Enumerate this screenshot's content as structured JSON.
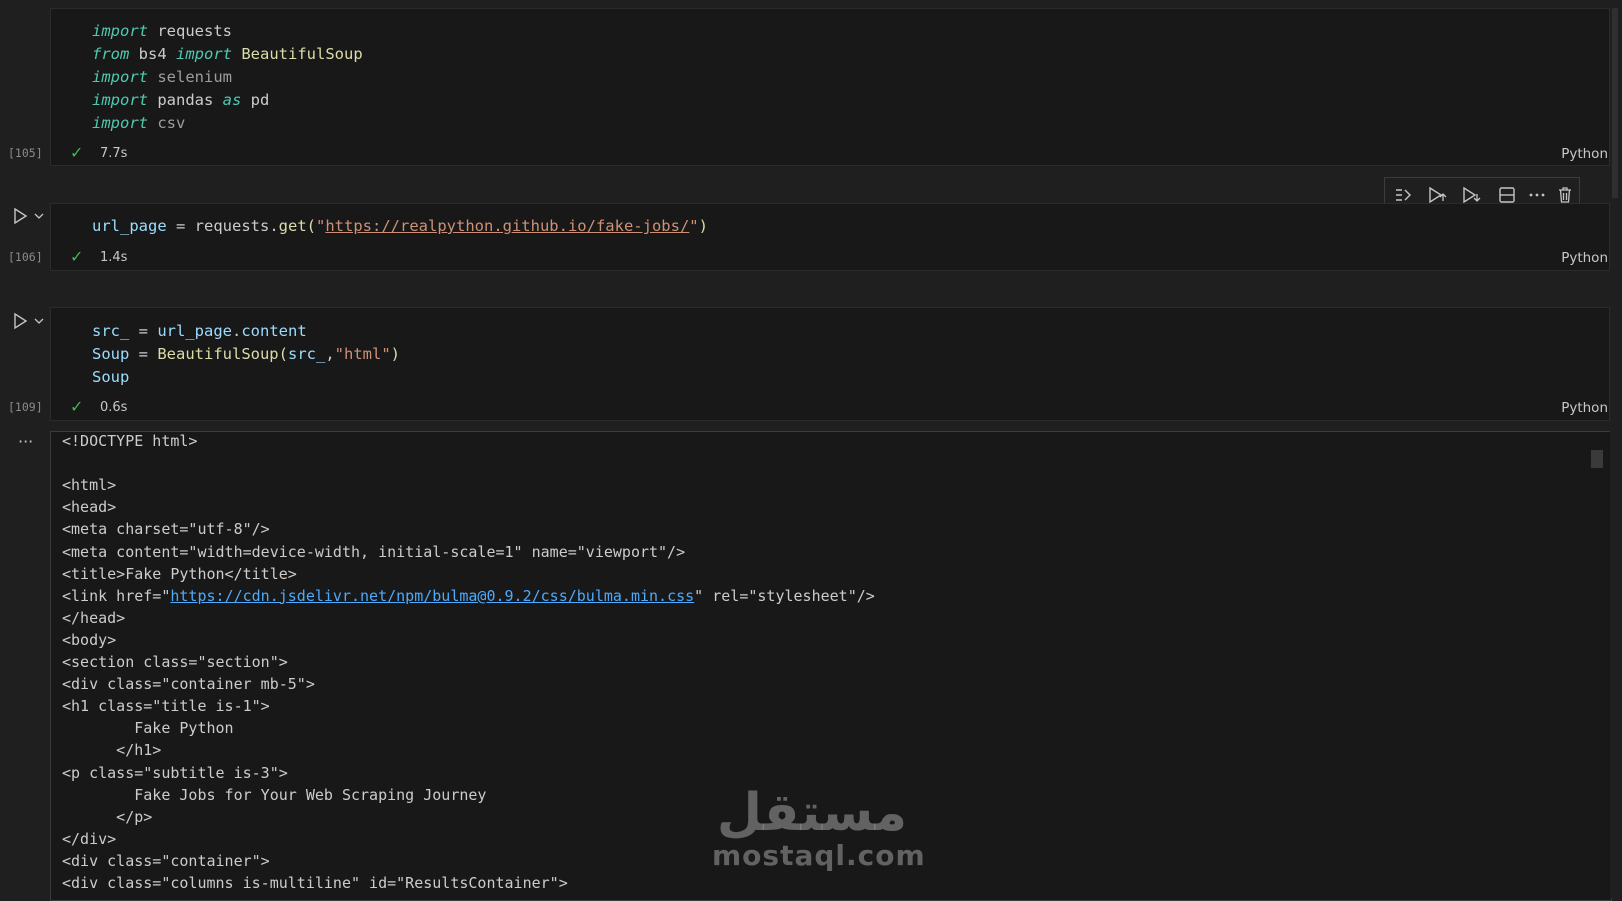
{
  "cells": [
    {
      "exec_count": "[105]",
      "duration": "7.7s",
      "language": "Python",
      "lines": [
        [
          {
            "t": "import",
            "c": "kw2"
          },
          {
            "t": " requests",
            "c": "mod"
          }
        ],
        [
          {
            "t": "from",
            "c": "kw2"
          },
          {
            "t": " bs4 ",
            "c": "mod"
          },
          {
            "t": "import",
            "c": "kw2"
          },
          {
            "t": " BeautifulSoup",
            "c": "cls"
          }
        ],
        [
          {
            "t": "import",
            "c": "kw2"
          },
          {
            "t": " selenium",
            "c": "mod-dim"
          }
        ],
        [
          {
            "t": "import",
            "c": "kw2"
          },
          {
            "t": " pandas ",
            "c": "mod"
          },
          {
            "t": "as",
            "c": "kw2"
          },
          {
            "t": " pd",
            "c": "mod"
          }
        ],
        [
          {
            "t": "import",
            "c": "kw2"
          },
          {
            "t": " csv",
            "c": "mod-dim"
          }
        ]
      ]
    },
    {
      "exec_count": "[106]",
      "duration": "1.4s",
      "language": "Python",
      "lines": [
        [
          {
            "t": "url_page",
            "c": "var"
          },
          {
            "t": " = ",
            "c": "mod"
          },
          {
            "t": "requests",
            "c": "mod"
          },
          {
            "t": ".",
            "c": "mod"
          },
          {
            "t": "get",
            "c": "fn"
          },
          {
            "t": "(",
            "c": "fn"
          },
          {
            "t": "\"",
            "c": "str"
          },
          {
            "t": "https://realpython.github.io/fake-jobs/",
            "c": "url"
          },
          {
            "t": "\"",
            "c": "str"
          },
          {
            "t": ")",
            "c": "fn"
          }
        ]
      ]
    },
    {
      "exec_count": "[109]",
      "duration": "0.6s",
      "language": "Python",
      "lines": [
        [
          {
            "t": "src_",
            "c": "var"
          },
          {
            "t": " = ",
            "c": "mod"
          },
          {
            "t": "url_page",
            "c": "var"
          },
          {
            "t": ".",
            "c": "mod"
          },
          {
            "t": "content",
            "c": "var"
          }
        ],
        [
          {
            "t": "Soup",
            "c": "var"
          },
          {
            "t": " = ",
            "c": "mod"
          },
          {
            "t": "BeautifulSoup",
            "c": "cls"
          },
          {
            "t": "(",
            "c": "fn"
          },
          {
            "t": "src_",
            "c": "var"
          },
          {
            "t": ",",
            "c": "mod"
          },
          {
            "t": "\"html\"",
            "c": "str"
          },
          {
            "t": ")",
            "c": "fn"
          }
        ],
        [
          {
            "t": "Soup",
            "c": "var"
          }
        ]
      ]
    }
  ],
  "output": {
    "more_label": "···",
    "lines": [
      "<!DOCTYPE html>",
      "",
      "<html>",
      "<head>",
      "<meta charset=\"utf-8\"/>",
      "<meta content=\"width=device-width, initial-scale=1\" name=\"viewport\"/>",
      "<title>Fake Python</title>",
      "<link href=\"{{LINK}}\" rel=\"stylesheet\"/>",
      "</head>",
      "<body>",
      "<section class=\"section\">",
      "<div class=\"container mb-5\">",
      "<h1 class=\"title is-1\">",
      "        Fake Python",
      "      </h1>",
      "<p class=\"subtitle is-3\">",
      "        Fake Jobs for Your Web Scraping Journey",
      "      </p>",
      "</div>",
      "<div class=\"container\">",
      "<div class=\"columns is-multiline\" id=\"ResultsContainer\">"
    ],
    "link": "https://cdn.jsdelivr.net/npm/bulma@0.9.2/css/bulma.min.css"
  },
  "toolbar": {
    "icons": [
      "execute-above-icon",
      "run-above-icon",
      "run-below-icon",
      "split-cell-icon",
      "more-actions-icon",
      "delete-cell-icon"
    ]
  },
  "watermark": {
    "arabic": "مستقل",
    "latin": "mostaql.com"
  },
  "colors": {
    "background": "#1f1f1f",
    "cell_background": "#181818",
    "success": "#3fb950",
    "link": "#4daafc",
    "string": "#ce9178",
    "keyword": "#4ec9b0",
    "function": "#dcdcaa",
    "variable": "#9cdcfe"
  }
}
